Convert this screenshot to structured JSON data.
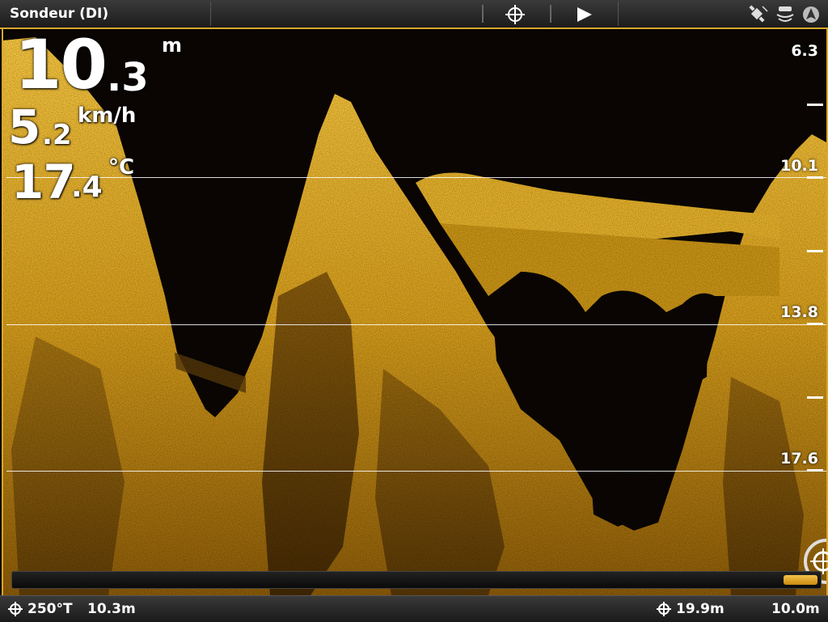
{
  "header": {
    "title": "Sondeur (DI)",
    "icons": [
      "crosshair-icon",
      "play-icon",
      "gps-icon",
      "sonar-icon",
      "compass-icon"
    ]
  },
  "readouts": {
    "depth_int": "10",
    "depth_dec": ".3",
    "depth_unit": "m",
    "speed_int": "5",
    "speed_dec": ".2",
    "speed_unit": "km/h",
    "temp_int": "17",
    "temp_dec": ".4",
    "temp_unit": "°C"
  },
  "depth_scale": [
    "6.3",
    "10.1",
    "13.8",
    "17.6"
  ],
  "footer": {
    "heading": "250°T",
    "depth_left": "10.3m",
    "cursor_distance": "19.9m",
    "range": "10.0m"
  },
  "colors": {
    "accent": "#d9a62c",
    "sonar_bright": "#f2c230",
    "sonar_dark": "#0b0604"
  }
}
